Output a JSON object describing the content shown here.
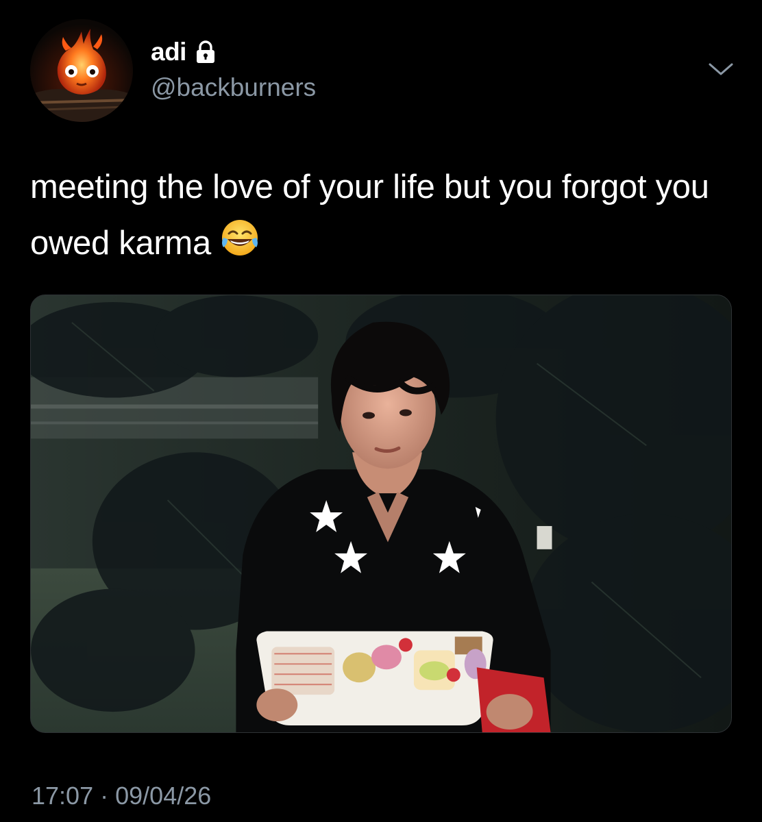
{
  "author": {
    "display_name": "adi",
    "handle": "@backburners",
    "protected": true,
    "avatar_icon": "fire-demon-avatar",
    "lock_icon": "lock-icon"
  },
  "tweet": {
    "text": "meeting the love of your life but you forgot you owed karma",
    "emoji": "😂",
    "emoji_name": "face-with-tears-of-joy"
  },
  "media": {
    "type": "photo"
  },
  "meta": {
    "time": "17:07",
    "separator": "·",
    "date": "09/04/26"
  },
  "colors": {
    "background": "#000000",
    "primary_text": "#ffffff",
    "secondary_text": "#8b98a5"
  },
  "icons": {
    "more": "chevron-down-icon"
  }
}
